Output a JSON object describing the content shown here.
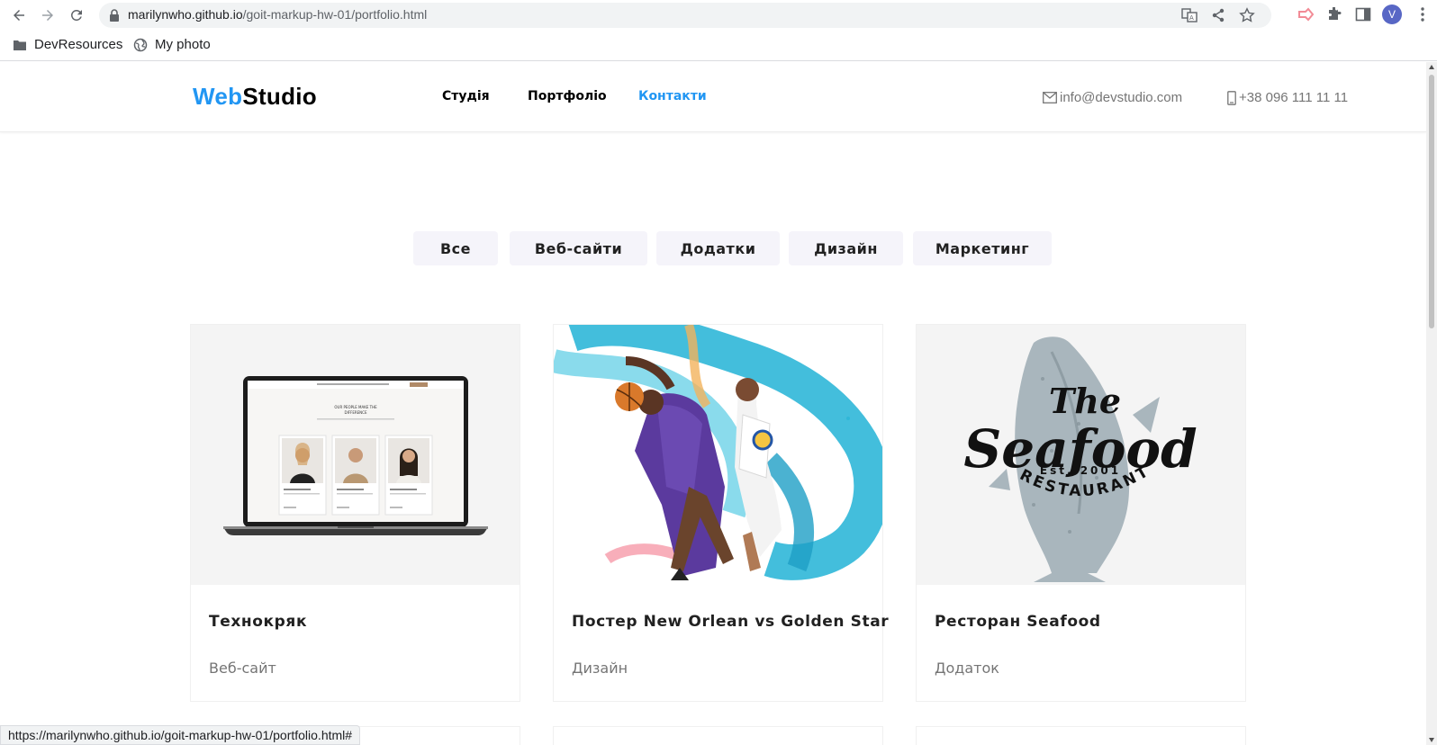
{
  "browser": {
    "url_host": "marilynwho.github.io",
    "url_path": "/goit-markup-hw-01/portfolio.html",
    "avatar_letter": "V",
    "bookmarks": [
      {
        "label": "DevResources",
        "icon": "folder-icon"
      },
      {
        "label": "My photo",
        "icon": "globe-icon"
      }
    ],
    "status_url": "https://marilynwho.github.io/goit-markup-hw-01/portfolio.html#"
  },
  "site": {
    "logo_web": "Web",
    "logo_studio": "Studio",
    "nav": [
      "Студія",
      "Портфоліо",
      "Контакти"
    ],
    "active_nav": "Контакти",
    "email": "info@devstudio.com",
    "phone": "+38 096 111 11 11",
    "accent_color": "#2196f3"
  },
  "filters": [
    "Все",
    "Веб-сайти",
    "Додатки",
    "Дизайн",
    "Маркетинг"
  ],
  "cards": [
    {
      "title": "Технокряк",
      "category": "Веб-сайт",
      "image": "laptop-mockup"
    },
    {
      "title": "Постер New Orlean vs Golden Star",
      "category": "Дизайн",
      "image": "basketball-poster"
    },
    {
      "title": "Ресторан Seafood",
      "category": "Додаток",
      "image": "seafood-logo"
    }
  ],
  "laptop_screen": {
    "heading_1": "OUR PEOPLE MAKE THE",
    "heading_2": "DIFFERENCE"
  },
  "seafood_logo": {
    "the": "The",
    "seafood": "Seafood",
    "est": "Est. 2001",
    "restaurant": "RESTAURANT"
  }
}
